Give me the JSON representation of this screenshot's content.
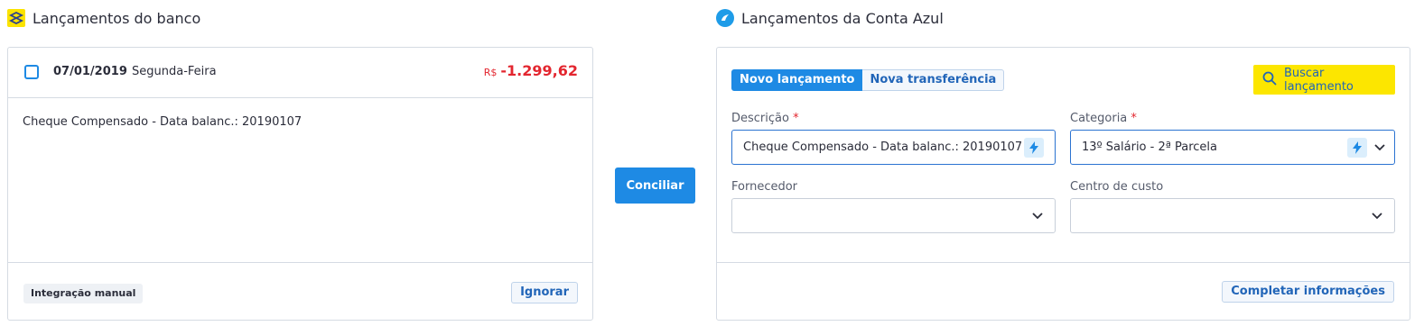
{
  "left_panel": {
    "title": "Lançamentos do banco",
    "logo_icon": "banco-do-brasil-logo",
    "transaction": {
      "checked": false,
      "date": "07/01/2019",
      "weekday": "Segunda-Feira",
      "currency": "R$",
      "amount": "-1.299,62",
      "description": "Cheque Compensado - Data balanc.: 20190107"
    },
    "tag": "Integração manual",
    "ignore_label": "Ignorar"
  },
  "conciliar_label": "Conciliar",
  "right_panel": {
    "title": "Lançamentos da Conta Azul",
    "logo_icon": "conta-azul-logo",
    "tabs": [
      {
        "label": "Novo lançamento",
        "active": true
      },
      {
        "label": "Nova transferência",
        "active": false
      }
    ],
    "search_button": "Buscar lançamento",
    "fields": {
      "descricao": {
        "label": "Descrição",
        "required_mark": "*",
        "value": "Cheque Compensado - Data balanc.: 20190107"
      },
      "categoria": {
        "label": "Categoria",
        "required_mark": "*",
        "value": "13º Salário - 2ª Parcela"
      },
      "fornecedor": {
        "label": "Fornecedor",
        "value": ""
      },
      "centro_custo": {
        "label": "Centro de custo",
        "value": ""
      }
    },
    "complete_button": "Completar informações"
  },
  "colors": {
    "primary": "#1e8ae4",
    "negative": "#e3262f",
    "highlight": "#fce600",
    "link": "#2165b8"
  }
}
